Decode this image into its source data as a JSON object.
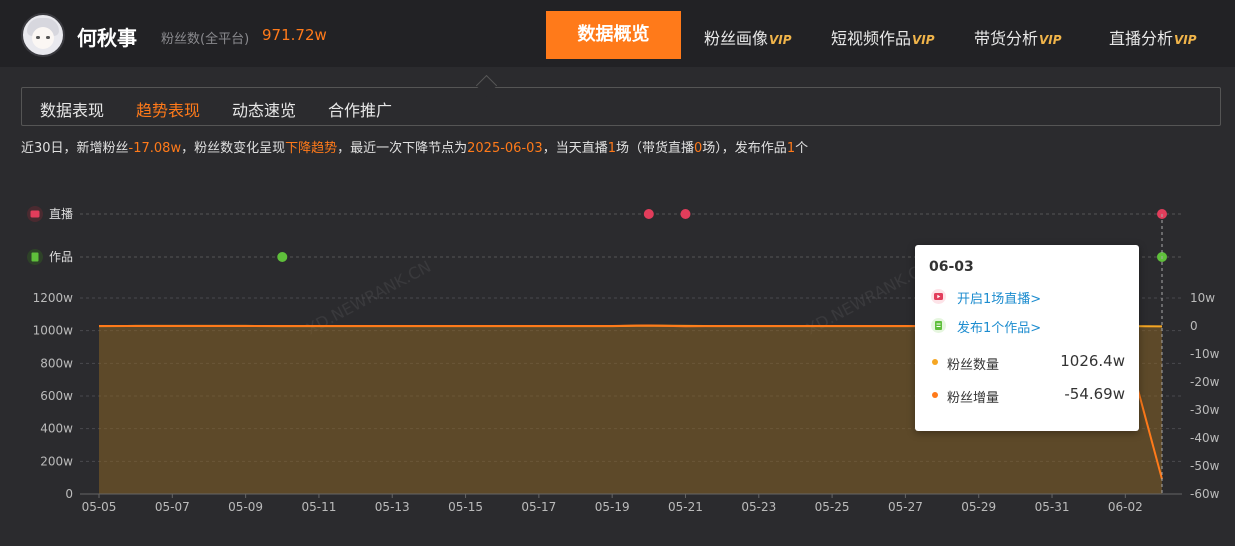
{
  "header": {
    "name": "何秋事",
    "fans_label": "粉丝数(全平台)",
    "fans_value": "971.72w",
    "nav_main": "数据概览",
    "nav": [
      {
        "label": "粉丝画像",
        "vip": "VIP"
      },
      {
        "label": "短视频作品",
        "vip": "VIP"
      },
      {
        "label": "带货分析",
        "vip": "VIP"
      },
      {
        "label": "直播分析",
        "vip": "VIP"
      }
    ]
  },
  "subtabs": [
    "数据表现",
    "趋势表现",
    "动态速览",
    "合作推广"
  ],
  "summary": {
    "p1": "近30日，新增粉丝",
    "v1": "-17.08w",
    "p2": "，粉丝数变化呈现",
    "v2": "下降趋势",
    "p3": "，最近一次下降节点为",
    "v3": "2025-06-03",
    "p4": "，当天直播",
    "v4": "1",
    "p5": "场（带货直播",
    "v5": "0",
    "p6": "场），发布作品",
    "v6": "1",
    "p7": "个"
  },
  "chart_data": {
    "type": "line",
    "categories": [
      "05-05",
      "05-06",
      "05-07",
      "05-08",
      "05-09",
      "05-10",
      "05-11",
      "05-12",
      "05-13",
      "05-14",
      "05-15",
      "05-16",
      "05-17",
      "05-18",
      "05-19",
      "05-20",
      "05-21",
      "05-22",
      "05-23",
      "05-24",
      "05-25",
      "05-26",
      "05-27",
      "05-28",
      "05-29",
      "05-30",
      "05-31",
      "06-01",
      "06-02",
      "06-03"
    ],
    "x_tick_labels": [
      "05-05",
      "05-07",
      "05-09",
      "05-11",
      "05-13",
      "05-15",
      "05-17",
      "05-19",
      "05-21",
      "05-23",
      "05-25",
      "05-27",
      "05-29",
      "05-31",
      "06-02"
    ],
    "y_left_ticks": [
      "1200w",
      "1000w",
      "800w",
      "600w",
      "400w",
      "200w",
      "0"
    ],
    "y_right_ticks": [
      "10w",
      "0",
      "-10w",
      "-20w",
      "-30w",
      "-40w",
      "-50w",
      "-60w"
    ],
    "ylim_left": [
      0,
      1200
    ],
    "ylim_right": [
      -60,
      10
    ],
    "series": [
      {
        "name": "粉丝数量",
        "color": "#f5a623",
        "values": [
          1028,
          1029,
          1029,
          1029,
          1029,
          1028,
          1028,
          1028,
          1028,
          1028,
          1028,
          1028,
          1028,
          1028,
          1028,
          1031,
          1029,
          1028,
          1028,
          1028,
          1028,
          1028,
          1028,
          1028,
          1028,
          1028,
          1028,
          1028,
          1028,
          1026.4
        ]
      },
      {
        "name": "粉丝增量",
        "color": "#ff7a1a",
        "values": [
          0,
          0,
          0,
          0,
          0,
          0,
          0,
          0,
          0,
          0,
          0,
          0,
          0,
          0,
          0,
          0.2,
          -0.1,
          0,
          0,
          0,
          0,
          0,
          0,
          0,
          0,
          0,
          0,
          0,
          -6,
          -54.69
        ]
      }
    ],
    "markers": {
      "live": {
        "label": "直播",
        "color": "#e23d5b",
        "dates": [
          "05-20",
          "05-21",
          "06-03"
        ]
      },
      "works": {
        "label": "作品",
        "color": "#5fbf3b",
        "dates": [
          "05-10",
          "06-03"
        ]
      }
    }
  },
  "tooltip": {
    "date": "06-03",
    "live_link": "开启1场直播>",
    "works_link": "发布1个作品>",
    "rows": [
      {
        "label": "粉丝数量",
        "value": "1026.4w",
        "color": "#f5a623"
      },
      {
        "label": "粉丝增量",
        "value": "-54.69w",
        "color": "#ff7a1a"
      }
    ]
  },
  "watermark": "XD.NEWRANK.CN"
}
